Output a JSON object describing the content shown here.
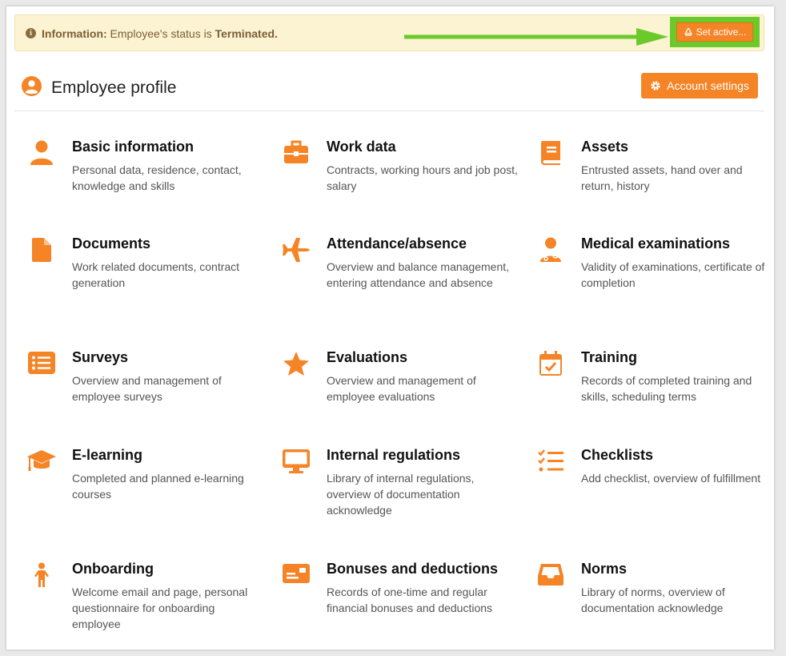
{
  "alert": {
    "label": "Information:",
    "text_prefix": "Employee's status is",
    "status": "Terminated."
  },
  "set_active_label": "Set active...",
  "header": {
    "title": "Employee profile",
    "account_settings_label": "Account settings"
  },
  "accent_color": "#f58426",
  "tiles": [
    {
      "title": "Basic information",
      "desc": "Personal data, residence, contact, knowledge and skills",
      "icon": "person-icon"
    },
    {
      "title": "Work data",
      "desc": "Contracts, working hours and job post, salary",
      "icon": "briefcase-icon"
    },
    {
      "title": "Assets",
      "desc": "Entrusted assets, hand over and return, history",
      "icon": "book-icon"
    },
    {
      "title": "Documents",
      "desc": "Work related documents, contract generation",
      "icon": "file-icon"
    },
    {
      "title": "Attendance/absence",
      "desc": "Overview and balance management, entering attendance and absence",
      "icon": "plane-icon"
    },
    {
      "title": "Medical examinations",
      "desc": "Validity of examinations, certificate of completion",
      "icon": "doctor-icon"
    },
    {
      "title": "Surveys",
      "desc": "Overview and management of employee surveys",
      "icon": "list-icon"
    },
    {
      "title": "Evaluations",
      "desc": "Overview and management of employee evaluations",
      "icon": "star-icon"
    },
    {
      "title": "Training",
      "desc": "Records of completed training and skills, scheduling terms",
      "icon": "calendar-check-icon"
    },
    {
      "title": "E-learning",
      "desc": "Completed and planned e-learning courses",
      "icon": "graduation-cap-icon"
    },
    {
      "title": "Internal regulations",
      "desc": "Library of internal regulations, overview of documentation acknowledge",
      "icon": "monitor-icon"
    },
    {
      "title": "Checklists",
      "desc": "Add checklist, overview of fulfillment",
      "icon": "checklist-icon"
    },
    {
      "title": "Onboarding",
      "desc": "Welcome email and page, personal questionnaire for onboarding employee",
      "icon": "child-icon"
    },
    {
      "title": "Bonuses and deductions",
      "desc": "Records of one-time and regular financial bonuses and deductions",
      "icon": "money-card-icon"
    },
    {
      "title": "Norms",
      "desc": "Library of norms, overview of documentation acknowledge",
      "icon": "inbox-icon"
    }
  ]
}
